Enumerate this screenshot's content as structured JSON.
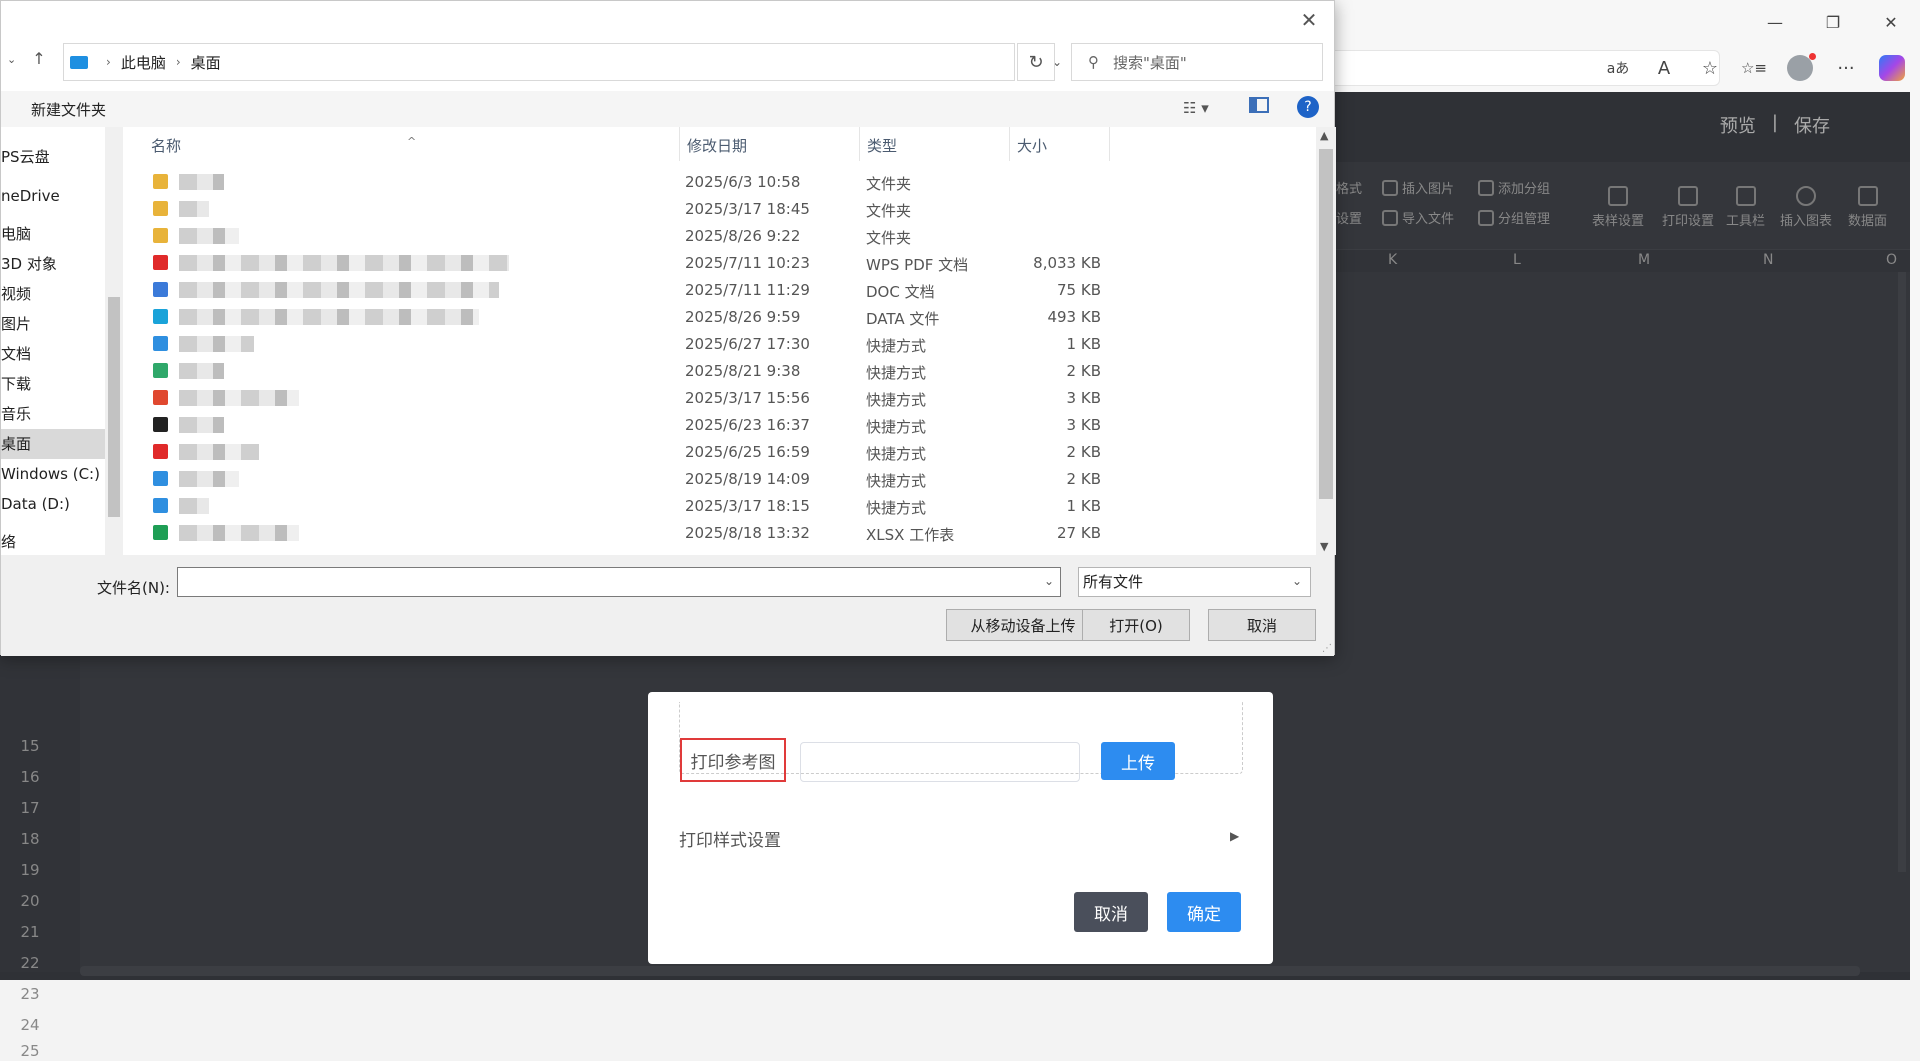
{
  "browser": {
    "window_controls": [
      "—",
      "❐",
      "✕"
    ],
    "icons": [
      "read-aloud-icon",
      "text-size-icon",
      "favorite-star-icon",
      "favorites-list-icon",
      "profile-avatar",
      "more-icon",
      "copilot-icon"
    ],
    "icon_glyphs": {
      "read": "aあ",
      "aa": "A",
      "star": "☆",
      "favs": "☆≡",
      "more": "···"
    }
  },
  "app": {
    "header_links": [
      "预览",
      "|",
      "保存"
    ],
    "toolbar_small": [
      "格式",
      "插入图片",
      "添加分组",
      "设置",
      "导入文件",
      "分组管理"
    ],
    "toolbar_big": [
      "表样设置",
      "打印设置",
      "工具栏",
      "插入图表",
      "数据面"
    ],
    "columns": [
      "K",
      "L",
      "M",
      "N",
      "O"
    ],
    "rows": [
      "15",
      "16",
      "17",
      "18",
      "19",
      "20",
      "21",
      "22",
      "23",
      "24",
      "25"
    ]
  },
  "modal": {
    "ref_label": "打印参考图",
    "upload_label": "上传",
    "style_setting": "打印样式设置",
    "cancel_label": "取消",
    "ok_label": "确定",
    "arrow": "▶"
  },
  "dialog": {
    "close": "✕",
    "path": [
      "此电脑",
      "桌面"
    ],
    "search_placeholder": "搜索\"桌面\"",
    "new_folder": "新建文件夹",
    "help": "?",
    "sidebar": [
      {
        "label": "PS云盘",
        "selected": false
      },
      {
        "label": "neDrive",
        "selected": false
      },
      {
        "label": "电脑",
        "selected": false
      },
      {
        "label": "3D 对象",
        "selected": false
      },
      {
        "label": "视频",
        "selected": false
      },
      {
        "label": "图片",
        "selected": false
      },
      {
        "label": "文档",
        "selected": false
      },
      {
        "label": "下载",
        "selected": false
      },
      {
        "label": "音乐",
        "selected": false
      },
      {
        "label": "桌面",
        "selected": true
      },
      {
        "label": "Windows (C:)",
        "selected": false
      },
      {
        "label": "Data (D:)",
        "selected": false
      },
      {
        "label": "络",
        "selected": false
      }
    ],
    "columns": {
      "name": "名称",
      "date": "修改日期",
      "type": "类型",
      "size": "大小"
    },
    "files": [
      {
        "date": "2025/6/3 10:58",
        "type": "文件夹",
        "size": "",
        "icon": "folder-icon",
        "color": "#e8b33a",
        "blur": 45
      },
      {
        "date": "2025/3/17 18:45",
        "type": "文件夹",
        "size": "",
        "icon": "folder-icon",
        "color": "#e8b33a",
        "blur": 30
      },
      {
        "date": "2025/8/26 9:22",
        "type": "文件夹",
        "size": "",
        "icon": "folder-icon",
        "color": "#e8b33a",
        "blur": 60
      },
      {
        "date": "2025/7/11 10:23",
        "type": "WPS PDF 文档",
        "size": "8,033 KB",
        "icon": "pdf-icon",
        "color": "#e02a2a",
        "blur": 330
      },
      {
        "date": "2025/7/11 11:29",
        "type": "DOC 文档",
        "size": "75 KB",
        "icon": "doc-icon",
        "color": "#3b7ad9",
        "blur": 320
      },
      {
        "date": "2025/8/26 9:59",
        "type": "DATA 文件",
        "size": "493 KB",
        "icon": "data-icon",
        "color": "#1aa3d9",
        "blur": 300
      },
      {
        "date": "2025/6/27 17:30",
        "type": "快捷方式",
        "size": "1 KB",
        "icon": "shortcut-icon",
        "color": "#2f8fe0",
        "blur": 75
      },
      {
        "date": "2025/8/21 9:38",
        "type": "快捷方式",
        "size": "2 KB",
        "icon": "shortcut-icon",
        "color": "#2fa86a",
        "blur": 45
      },
      {
        "date": "2025/3/17 15:56",
        "type": "快捷方式",
        "size": "3 KB",
        "icon": "chrome-icon",
        "color": "#e0482f",
        "blur": 120
      },
      {
        "date": "2025/6/23 16:37",
        "type": "快捷方式",
        "size": "3 KB",
        "icon": "app-icon",
        "color": "#222222",
        "blur": 45
      },
      {
        "date": "2025/6/25 16:59",
        "type": "快捷方式",
        "size": "2 KB",
        "icon": "wps-icon",
        "color": "#e02a2a",
        "blur": 80
      },
      {
        "date": "2025/8/19 14:09",
        "type": "快捷方式",
        "size": "2 KB",
        "icon": "shortcut-icon",
        "color": "#2f8fe0",
        "blur": 60
      },
      {
        "date": "2025/3/17 18:15",
        "type": "快捷方式",
        "size": "1 KB",
        "icon": "shortcut-icon",
        "color": "#2f8fe0",
        "blur": 30
      },
      {
        "date": "2025/8/18 13:32",
        "type": "XLSX 工作表",
        "size": "27 KB",
        "icon": "xlsx-icon",
        "color": "#1e9e55",
        "blur": 120
      }
    ],
    "filename_label": "文件名(N):",
    "filename_value": "",
    "filter_label": "所有文件",
    "btn_mobile": "从移动设备上传",
    "btn_open": "打开(O)",
    "btn_cancel": "取消"
  }
}
